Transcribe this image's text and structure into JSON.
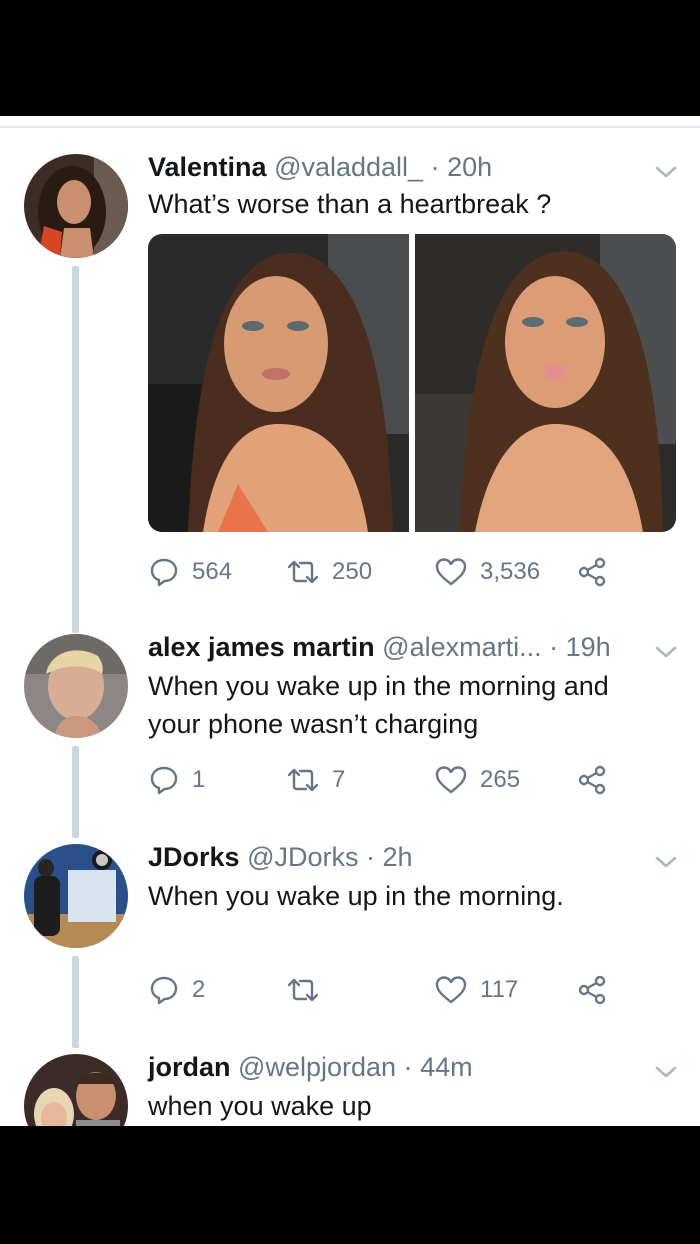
{
  "colors": {
    "text": "#14171a",
    "secondary": "#657786",
    "thread_line": "#ccd6dd"
  },
  "tweets": [
    {
      "name": "Valentina",
      "handle": "@valaddall_",
      "dot": "·",
      "time": "20h",
      "text": "What’s worse than a heartbreak ?",
      "has_media": true,
      "avatar_icon": "avatar-photo",
      "replies": "564",
      "retweets": "250",
      "likes": "3,536"
    },
    {
      "name": "alex james martin",
      "handle": "@alexmarti...",
      "dot": "·",
      "time": "19h",
      "text": "When you wake up in the morning and your phone wasn’t charging",
      "avatar_icon": "avatar-photo",
      "replies": "1",
      "retweets": "7",
      "likes": "265"
    },
    {
      "name": "JDorks",
      "handle": "@JDorks",
      "dot": "·",
      "time": "2h",
      "text": "When you wake up in the morning.",
      "avatar_icon": "avatar-photo",
      "replies": "2",
      "retweets": "",
      "likes": "117"
    },
    {
      "name": "jordan",
      "handle": "@welpjordan",
      "dot": "·",
      "time": "44m",
      "text": "when you wake up",
      "avatar_icon": "avatar-photo"
    }
  ]
}
